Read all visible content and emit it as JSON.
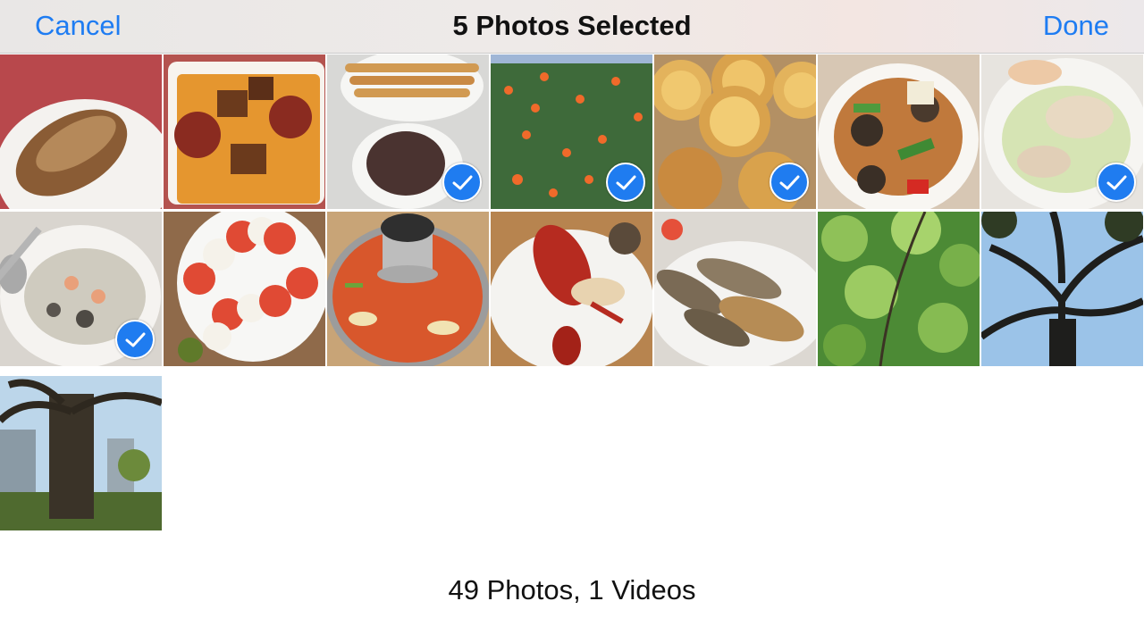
{
  "navbar": {
    "cancel_label": "Cancel",
    "title": "5 Photos Selected",
    "done_label": "Done"
  },
  "colors": {
    "accent": "#1e7cf2",
    "check_fill": "#1f7cf0"
  },
  "photos": [
    {
      "subject": "bread-roll",
      "selected": false
    },
    {
      "subject": "stew-with-sausage",
      "selected": false
    },
    {
      "subject": "churros-chocolate",
      "selected": true
    },
    {
      "subject": "orange-tree",
      "selected": true
    },
    {
      "subject": "egg-tarts",
      "selected": true
    },
    {
      "subject": "stir-fry-vegetables",
      "selected": false
    },
    {
      "subject": "shrimp-salad",
      "selected": true
    },
    {
      "subject": "seafood-rice",
      "selected": true
    },
    {
      "subject": "caprese-salad",
      "selected": false
    },
    {
      "subject": "hot-pot-soup",
      "selected": false
    },
    {
      "subject": "lobster-plate",
      "selected": false
    },
    {
      "subject": "grilled-fish",
      "selected": false
    },
    {
      "subject": "green-leaves",
      "selected": false
    },
    {
      "subject": "tree-canopy",
      "selected": false
    },
    {
      "subject": "old-tree-park",
      "selected": false
    }
  ],
  "footer": {
    "summary": "49 Photos, 1 Videos"
  }
}
